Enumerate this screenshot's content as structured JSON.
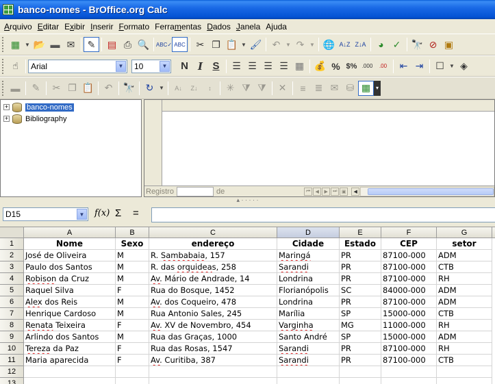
{
  "window": {
    "title": "banco-nomes - BrOffice.org Calc"
  },
  "menu": [
    {
      "label": "Arquivo",
      "key": "A"
    },
    {
      "label": "Editar",
      "key": "E"
    },
    {
      "label": "Exibir",
      "key": "x"
    },
    {
      "label": "Inserir",
      "key": "I"
    },
    {
      "label": "Formato",
      "key": "F"
    },
    {
      "label": "Ferramentas",
      "key": "m"
    },
    {
      "label": "Dados",
      "key": "D"
    },
    {
      "label": "Janela",
      "key": "J"
    },
    {
      "label": "Ajuda",
      "key": "j"
    }
  ],
  "format_toolbar": {
    "font_name": "Arial",
    "font_size": "10",
    "bold_label": "N",
    "italic_label": "I",
    "underline_label": "S",
    "percent_label": "%",
    "currency_label": "$%",
    "add_decimal_label": ".000",
    "del_decimal_label": ".00"
  },
  "datasource": {
    "tree": [
      {
        "label": "banco-nomes",
        "selected": true
      },
      {
        "label": "Bibliography",
        "selected": false
      }
    ],
    "nav": {
      "record_label": "Registro",
      "of_label": "de"
    }
  },
  "formula_bar": {
    "cell_ref": "D15",
    "sum_label": "Σ",
    "equals_label": "="
  },
  "sheet": {
    "columns": [
      "A",
      "B",
      "C",
      "D",
      "E",
      "F",
      "G"
    ],
    "active_column": "D",
    "row_numbers": [
      "1",
      "2",
      "3",
      "4",
      "5",
      "6",
      "7",
      "8",
      "9",
      "10",
      "11",
      "12",
      "13"
    ],
    "header": [
      "Nome",
      "Sexo",
      "endereço",
      "Cidade",
      "Estado",
      "CEP",
      "setor"
    ],
    "rows": [
      [
        "José de Oliveira",
        "M",
        "R. Sambabaia, 157",
        "Maringá",
        "PR",
        "87100-000",
        "ADM"
      ],
      [
        "Paulo dos Santos",
        "M",
        "R. das orquideas, 258",
        "Sarandi",
        "PR",
        "87100-000",
        "CTB"
      ],
      [
        "Robison da Cruz",
        "M",
        "Av. Mário de Andrade, 14",
        "Londrina",
        "PR",
        "87100-000",
        "RH"
      ],
      [
        "Raquel  Silva",
        "F",
        "Rua do Bosque, 1452",
        "Florianópolis",
        "SC",
        "84000-000",
        "ADM"
      ],
      [
        "Alex dos Reis",
        "M",
        "Av. dos Coqueiro, 478",
        "Londrina",
        "PR",
        "87100-000",
        "ADM"
      ],
      [
        "Henrique Cardoso",
        "M",
        "Rua Antonio Sales, 245",
        "Marília",
        "SP",
        "15000-000",
        "CTB"
      ],
      [
        "Renata Teixeira",
        "F",
        "Av. XV de Novembro, 454",
        "Varginha",
        "MG",
        "11000-000",
        "RH"
      ],
      [
        "Arlindo dos Santos",
        "M",
        "Rua das Graças, 1000",
        "Santo André",
        "SP",
        "15000-000",
        "ADM"
      ],
      [
        "Tereza da Paz",
        "F",
        "Rua das Rosas, 1547",
        "Sarandi",
        "PR",
        "87100-000",
        "RH"
      ],
      [
        "Maria aparecida",
        "F",
        "Av. Curitiba, 387",
        "Sarandi",
        "PR",
        "87100-000",
        "CTB"
      ]
    ]
  }
}
